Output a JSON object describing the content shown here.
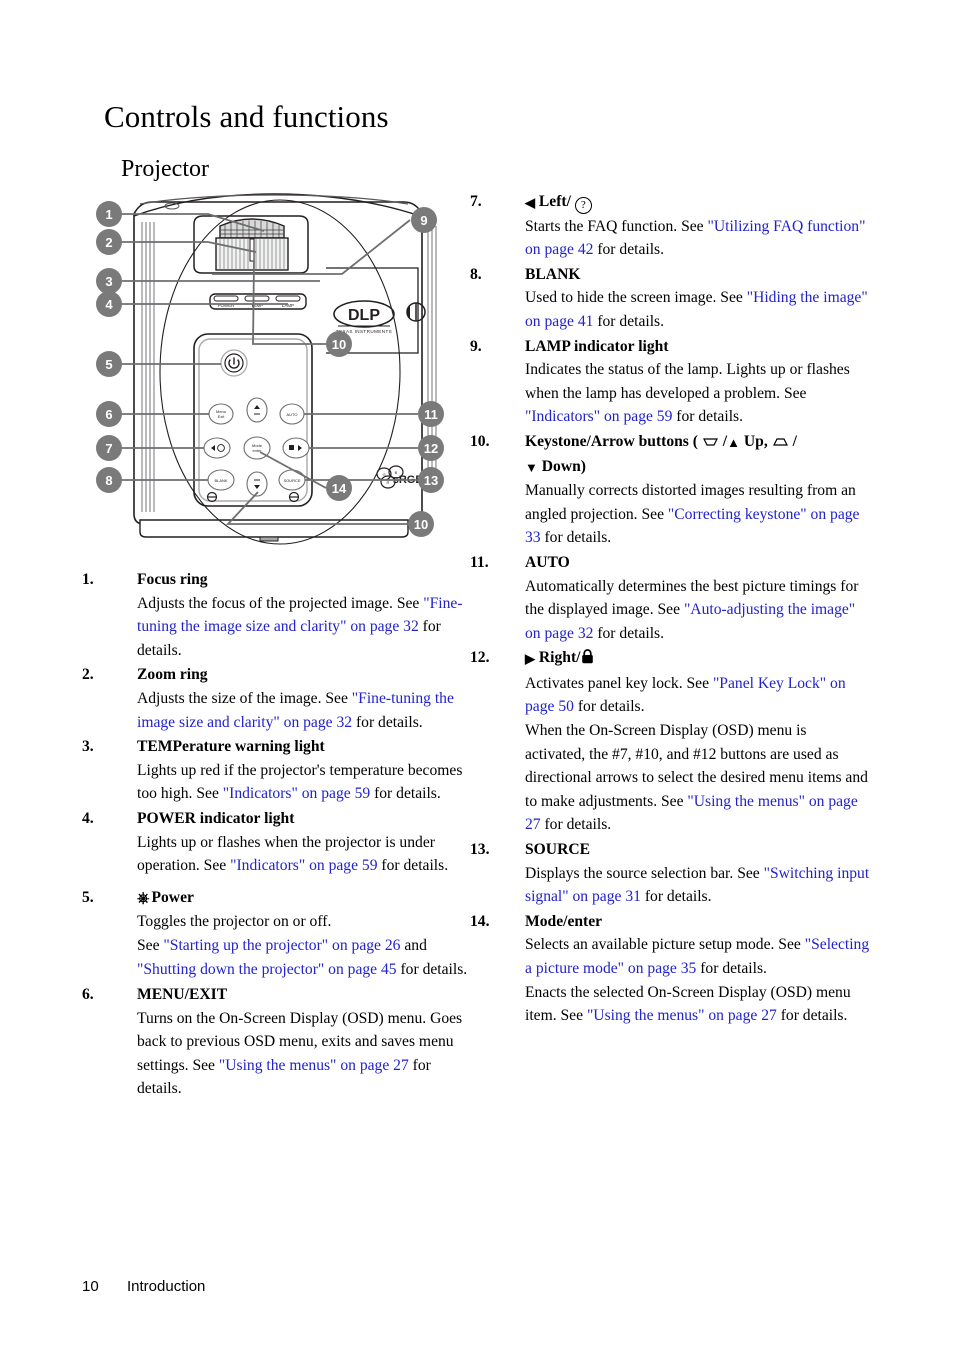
{
  "page": {
    "title": "Controls and functions",
    "subtitle": "Projector",
    "footer_page_number": "10",
    "footer_section": "Introduction",
    "link_color": "#2222cc",
    "callout_badge_color": "#7a7a7a"
  },
  "figure": {
    "name": "projector-top-view-diagram",
    "callouts": [
      "1",
      "2",
      "3",
      "4",
      "5",
      "6",
      "7",
      "8",
      "9",
      "10",
      "11",
      "12",
      "13",
      "14",
      "10"
    ],
    "indicator_labels": [
      "POWER",
      "TEMP",
      "LAMP"
    ],
    "logos": [
      "DLP",
      "TEXAS INSTRUMENTS",
      "sRGB"
    ],
    "buttons": [
      {
        "label": "Menu\nExit"
      },
      {
        "label": "Up"
      },
      {
        "label": "AUTO"
      },
      {
        "label": "Left"
      },
      {
        "label": "Mode\nEnter"
      },
      {
        "label": "Right"
      },
      {
        "label": "BLANK"
      },
      {
        "label": "Down"
      },
      {
        "label": "SOURCE"
      }
    ]
  },
  "items_left": [
    {
      "num": "1.",
      "term": "Focus ring",
      "desc_parts": [
        {
          "t": "Adjusts the focus of the projected image. See ",
          "link": false
        },
        {
          "t": "\"Fine-tuning the image size and clarity\" on page 32",
          "link": true
        },
        {
          "t": " for details.",
          "link": false
        }
      ]
    },
    {
      "num": "2.",
      "term": "Zoom ring",
      "desc_parts": [
        {
          "t": "Adjusts the size of the image. See ",
          "link": false
        },
        {
          "t": "\"Fine-tuning the image size and clarity\" on page 32",
          "link": true
        },
        {
          "t": " for details.",
          "link": false
        }
      ]
    },
    {
      "num": "3.",
      "term": "TEMPerature warning light",
      "desc_parts": [
        {
          "t": "Lights up red if the projector's temperature becomes too high. See ",
          "link": false
        },
        {
          "t": "\"Indicators\" on page 59",
          "link": true
        },
        {
          "t": " for details.",
          "link": false
        }
      ]
    },
    {
      "num": "4.",
      "term": "POWER indicator light",
      "desc_parts": [
        {
          "t": "Lights up or flashes when the projector is under operation. See ",
          "link": false
        },
        {
          "t": "\"Indicators\" on page 59",
          "link": true
        },
        {
          "t": " for details.",
          "link": false
        }
      ]
    },
    {
      "num": "5.",
      "term_icon": "power-icon",
      "term": "Power",
      "desc_parts": [
        {
          "t": "Toggles the projector on or off.",
          "link": false
        },
        {
          "t": "\nSee ",
          "link": false
        },
        {
          "t": "\"Starting up the projector\" on page 26",
          "link": true
        },
        {
          "t": " and ",
          "link": false
        },
        {
          "t": "\"Shutting down the projector\" on page 45",
          "link": true
        },
        {
          "t": " for details.",
          "link": false
        }
      ]
    },
    {
      "num": "6.",
      "term": "MENU/EXIT",
      "desc_parts": [
        {
          "t": "Turns on the On-Screen Display (OSD) menu. Goes back to previous OSD menu, exits and saves menu settings. See ",
          "link": false
        },
        {
          "t": "\"Using the menus\" on page 27",
          "link": true
        },
        {
          "t": " for details.",
          "link": false
        }
      ]
    }
  ],
  "items_right": [
    {
      "num": "7.",
      "term_prefix_icon": "left-arrow-icon",
      "term": "Left/",
      "term_suffix_icon": "faq-question-icon",
      "desc_parts": [
        {
          "t": "Starts the FAQ function. See ",
          "link": false
        },
        {
          "t": "\"Utilizing FAQ function\" on page 42",
          "link": true
        },
        {
          "t": " for details.",
          "link": false
        }
      ]
    },
    {
      "num": "8.",
      "term": "BLANK",
      "desc_parts": [
        {
          "t": "Used to hide the screen image. See ",
          "link": false
        },
        {
          "t": "\"Hiding the image\" on page 41",
          "link": true
        },
        {
          "t": " for details.",
          "link": false
        }
      ]
    },
    {
      "num": "9.",
      "term": "LAMP indicator light",
      "desc_parts": [
        {
          "t": "Indicates the status of the lamp. Lights up or flashes when the lamp has developed a problem. See ",
          "link": false
        },
        {
          "t": "\"Indicators\" on page 59",
          "link": true
        },
        {
          "t": " for details.",
          "link": false
        }
      ]
    },
    {
      "num": "10.",
      "term_keystone": true,
      "term": "Keystone/Arrow buttons (",
      "term_mid": "/",
      "term_up": "Up,",
      "term_tail": "/",
      "term_down": "Down)",
      "desc_parts": [
        {
          "t": "Manually corrects distorted images resulting from an angled projection. See ",
          "link": false
        },
        {
          "t": "\"Correcting keystone\" on page 33",
          "link": true
        },
        {
          "t": " for details.",
          "link": false
        }
      ]
    },
    {
      "num": "11.",
      "term": "AUTO",
      "desc_parts": [
        {
          "t": "Automatically determines the best picture timings for the displayed image. See ",
          "link": false
        },
        {
          "t": "\"Auto-adjusting the image\" on page 32",
          "link": true
        },
        {
          "t": " for details.",
          "link": false
        }
      ]
    },
    {
      "num": "12.",
      "term_prefix_icon": "right-arrow-icon",
      "term": "Right/",
      "term_suffix_icon": "lock-icon",
      "desc_parts": [
        {
          "t": "Activates panel key lock. See ",
          "link": false
        },
        {
          "t": "\"Panel Key Lock\" on page 50",
          "link": true
        },
        {
          "t": " for details.",
          "link": false
        }
      ],
      "desc2_parts": [
        {
          "t": "When the On-Screen Display (OSD) menu is activated, the #7, #10, and #12 buttons are used as directional arrows to select the desired menu items and to make adjustments. See ",
          "link": false
        },
        {
          "t": "\"Using the menus\" on page 27",
          "link": true
        },
        {
          "t": " for details.",
          "link": false
        }
      ]
    },
    {
      "num": "13.",
      "term": "SOURCE",
      "desc_parts": [
        {
          "t": "Displays the source selection bar. See ",
          "link": false
        },
        {
          "t": "\"Switching input signal\" on page 31",
          "link": true
        },
        {
          "t": " for details.",
          "link": false
        }
      ]
    },
    {
      "num": "14.",
      "term": "Mode/enter",
      "desc_parts": [
        {
          "t": "Selects an available picture setup mode. See ",
          "link": false
        },
        {
          "t": "\"Selecting a picture mode\" on page 35",
          "link": true
        },
        {
          "t": " for details.",
          "link": false
        }
      ],
      "desc2_parts": [
        {
          "t": "Enacts the selected On-Screen Display (OSD) menu item. See ",
          "link": false
        },
        {
          "t": "\"Using the menus\" on page 27",
          "link": true
        },
        {
          "t": " for details.",
          "link": false
        }
      ]
    }
  ]
}
